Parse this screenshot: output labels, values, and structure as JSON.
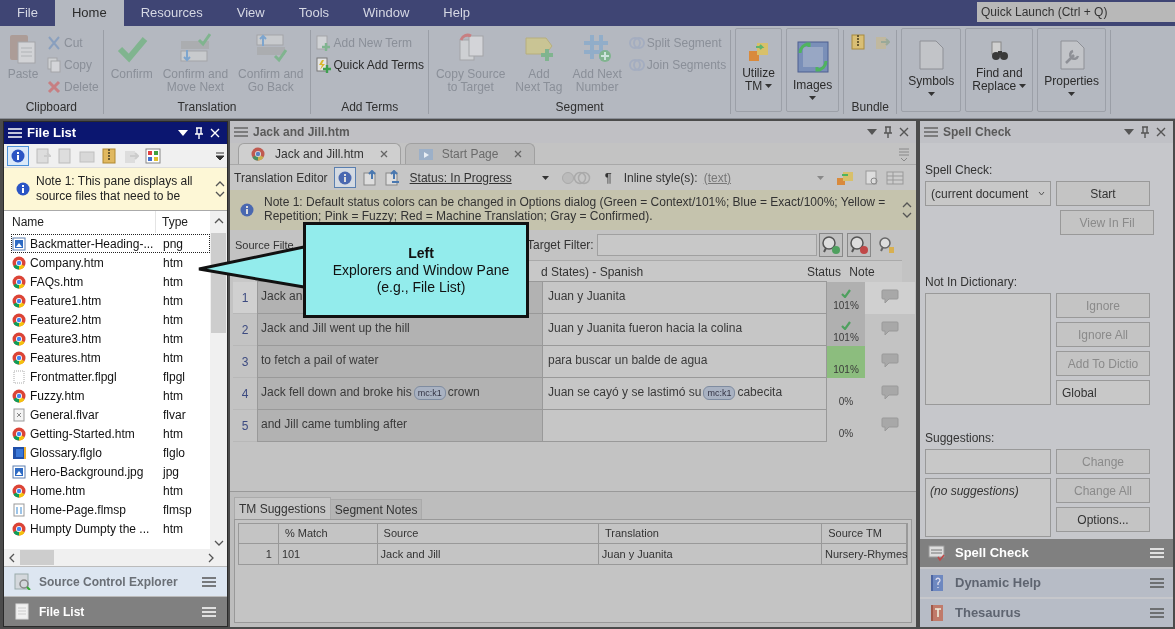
{
  "menu": [
    {
      "label": "File",
      "selected": false
    },
    {
      "label": "Home",
      "selected": true
    },
    {
      "label": "Resources",
      "selected": false
    },
    {
      "label": "View",
      "selected": false
    },
    {
      "label": "Tools",
      "selected": false
    },
    {
      "label": "Window",
      "selected": false
    },
    {
      "label": "Help",
      "selected": false
    }
  ],
  "quick_launch": {
    "placeholder": "Quick Launch (Ctrl + Q)"
  },
  "ribbon": [
    {
      "label": "Clipboard",
      "buttons": [
        {
          "kind": "large",
          "label": "Paste",
          "disabled": true
        },
        {
          "kind": "small",
          "label": "Cut",
          "disabled": true
        },
        {
          "kind": "small",
          "label": "Copy",
          "disabled": true
        },
        {
          "kind": "small",
          "label": "Delete",
          "disabled": true
        }
      ]
    },
    {
      "label": "Translation",
      "buttons": [
        {
          "kind": "large",
          "label": "Confirm",
          "disabled": true
        },
        {
          "kind": "large",
          "label": "Confirm and\nMove Next",
          "disabled": true
        },
        {
          "kind": "large",
          "label": "Confirm and\nGo Back",
          "disabled": true
        }
      ]
    },
    {
      "label": "Add Terms",
      "buttons": [
        {
          "kind": "small",
          "label": "Add New Term",
          "disabled": true
        },
        {
          "kind": "small",
          "label": "Quick Add Terms",
          "disabled": false
        }
      ]
    },
    {
      "label": "Segment",
      "buttons": [
        {
          "kind": "large",
          "label": "Copy Source\nto Target",
          "disabled": true
        },
        {
          "kind": "large",
          "label": "Add\nNext Tag",
          "disabled": true
        },
        {
          "kind": "large",
          "label": "Add Next\nNumber",
          "disabled": true
        },
        {
          "kind": "small",
          "label": "Split Segment",
          "disabled": true
        },
        {
          "kind": "small",
          "label": "Join Segments",
          "disabled": true
        }
      ]
    },
    {
      "buttons": [
        {
          "kind": "boxed",
          "label": "Utilize\nTM",
          "disabled": false,
          "menu": true
        },
        {
          "kind": "boxed",
          "label": "Images",
          "disabled": false,
          "menu": true
        }
      ]
    },
    {
      "label": "Bundle",
      "buttons": [
        {
          "kind": "icon",
          "disabled": false
        },
        {
          "kind": "icon",
          "disabled": true
        }
      ]
    },
    {
      "buttons": [
        {
          "kind": "boxed",
          "label": "Symbols",
          "disabled": false,
          "menu": true
        },
        {
          "kind": "boxed",
          "label": "Find and\nReplace",
          "disabled": false,
          "menu": true
        },
        {
          "kind": "boxed",
          "label": "Properties",
          "disabled": false,
          "menu": true
        }
      ]
    }
  ],
  "file_list": {
    "title": "File List",
    "note": "Note 1: This pane displays all source files that need to be",
    "columns": [
      "Name",
      "Type"
    ],
    "files": [
      {
        "name": "Backmatter-Heading-...",
        "type": "png",
        "kind": "image",
        "selected": true
      },
      {
        "name": "Company.htm",
        "type": "htm",
        "kind": "web",
        "selected": false
      },
      {
        "name": "FAQs.htm",
        "type": "htm",
        "kind": "web",
        "selected": false
      },
      {
        "name": "Feature1.htm",
        "type": "htm",
        "kind": "web",
        "selected": false
      },
      {
        "name": "Feature2.htm",
        "type": "htm",
        "kind": "web",
        "selected": false
      },
      {
        "name": "Feature3.htm",
        "type": "htm",
        "kind": "web",
        "selected": false
      },
      {
        "name": "Features.htm",
        "type": "htm",
        "kind": "web",
        "selected": false
      },
      {
        "name": "Frontmatter.flpgl",
        "type": "flpgl",
        "kind": "layout",
        "selected": false
      },
      {
        "name": "Fuzzy.htm",
        "type": "htm",
        "kind": "web",
        "selected": false
      },
      {
        "name": "General.flvar",
        "type": "flvar",
        "kind": "variables",
        "selected": false
      },
      {
        "name": "Getting-Started.htm",
        "type": "htm",
        "kind": "web",
        "selected": false
      },
      {
        "name": "Glossary.flglo",
        "type": "flglo",
        "kind": "glossary",
        "selected": false
      },
      {
        "name": "Hero-Background.jpg",
        "type": "jpg",
        "kind": "image",
        "selected": false
      },
      {
        "name": "Home.htm",
        "type": "htm",
        "kind": "web",
        "selected": false
      },
      {
        "name": "Home-Page.flmsp",
        "type": "flmsp",
        "kind": "skin",
        "selected": false
      },
      {
        "name": "Humpty Dumpty the ...",
        "type": "htm",
        "kind": "web",
        "selected": false
      }
    ],
    "tabs": [
      {
        "label": "Source Control Explorer",
        "selected": false
      },
      {
        "label": "File List",
        "selected": true
      }
    ]
  },
  "editor": {
    "title": "Jack and Jill.htm",
    "tabs": [
      {
        "label": "Jack and Jill.htm",
        "selected": true
      },
      {
        "label": "Start Page",
        "selected": false
      }
    ],
    "toolbar_label": "Translation Editor",
    "status_filter": "Status: In Progress",
    "marks_symbol": "¶",
    "inline_label": "Inline style(s):",
    "inline_value": "(text)",
    "note": "Note 1: Default status colors can be changed in Options dialog (Green = Context/101%; Blue = Exact/100%; Yellow = Repetition; Pink = Fuzzy; Red = Machine Translation; Gray = Confirmed).",
    "source_filter_label": "Source Filte",
    "target_filter_label": "Target Filter:",
    "columns": {
      "target": "d States) - Spanish",
      "status": "Status",
      "note": "Note"
    },
    "segments": [
      {
        "number": "1",
        "selected": true,
        "source": [
          {
            "kind": "text",
            "text": "Jack an"
          }
        ],
        "target": [
          {
            "kind": "text",
            "text": "Juan y Juanita"
          }
        ],
        "status": "101%",
        "confirmed": true,
        "color": "#b0b0b0"
      },
      {
        "number": "2",
        "selected": false,
        "source": [
          {
            "kind": "text",
            "text": "Jack and Jill went up the hill"
          }
        ],
        "target": [
          {
            "kind": "text",
            "text": "Juan y Juanita fueron hacia la colina"
          }
        ],
        "status": "101%",
        "confirmed": true,
        "color": "#b0b0b0"
      },
      {
        "number": "3",
        "selected": false,
        "source": [
          {
            "kind": "text",
            "text": "to fetch a pail of water"
          }
        ],
        "target": [
          {
            "kind": "text",
            "text": "para buscar un balde de agua"
          }
        ],
        "status": "101%",
        "confirmed": false,
        "color": "#8cbd7e"
      },
      {
        "number": "4",
        "selected": false,
        "source": [
          {
            "kind": "text",
            "text": "Jack fell down and broke his"
          },
          {
            "kind": "tag",
            "text": "mc:k1"
          },
          {
            "kind": "text",
            "text": "crown"
          }
        ],
        "target": [
          {
            "kind": "text",
            "text": "Juan se cayó y se lastimó su"
          },
          {
            "kind": "tag",
            "text": "mc:k1"
          },
          {
            "kind": "text",
            "text": "cabecita"
          }
        ],
        "status": "0%",
        "confirmed": false
      },
      {
        "number": "5",
        "selected": false,
        "source": [
          {
            "kind": "text",
            "text": "and Jill came tumbling after"
          }
        ],
        "status": "0%",
        "confirmed": false
      }
    ]
  },
  "tm_panel": {
    "tabs": [
      {
        "label": "TM Suggestions",
        "selected": true
      },
      {
        "label": "Segment Notes",
        "selected": false
      }
    ],
    "columns": [
      "% Match",
      "Source",
      "Translation",
      "Source TM"
    ],
    "rows": [
      {
        "number": "1",
        "cells": [
          "101",
          "Jack and Jill",
          "Juan y Juanita",
          "Nursery-Rhymes"
        ]
      }
    ]
  },
  "spell_check": {
    "title": "Spell Check",
    "scope_label": "Spell Check:",
    "scope": "(current document",
    "start": {
      "label": "Start",
      "disabled": false
    },
    "view": {
      "label": "View In Fil",
      "disabled": true
    },
    "not_in_dictionary_label": "Not In Dictionary:",
    "dictionary_buttons": [
      {
        "label": "Ignore",
        "disabled": true
      },
      {
        "label": "Ignore All",
        "disabled": true
      },
      {
        "label": "Add To Dictio",
        "disabled": true
      }
    ],
    "dictionary": "Global",
    "suggestions_label": "Suggestions:",
    "suggestion_buttons": [
      {
        "label": "Change",
        "disabled": true
      },
      {
        "label": "Change All",
        "disabled": true
      },
      {
        "label": "Options...",
        "disabled": false
      }
    ],
    "suggestions_empty": "(no suggestions)",
    "tabs": [
      {
        "label": "Spell Check",
        "selected": true
      },
      {
        "label": "Dynamic Help",
        "selected": false
      },
      {
        "label": "Thesaurus",
        "selected": false
      }
    ]
  },
  "callout": {
    "title": "Left",
    "lines": [
      "Explorers and Window Pane",
      "(e.g., File List)"
    ]
  }
}
